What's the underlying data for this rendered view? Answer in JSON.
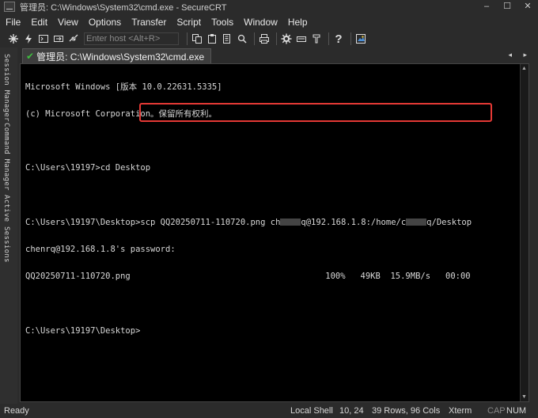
{
  "window": {
    "title": "管理员: C:\\Windows\\System32\\cmd.exe - SecureCRT",
    "controls": [
      "–",
      "☐",
      "✕"
    ]
  },
  "menu": {
    "items": [
      "File",
      "Edit",
      "View",
      "Options",
      "Transfer",
      "Script",
      "Tools",
      "Window",
      "Help"
    ]
  },
  "toolbar": {
    "host_placeholder": "Enter host <Alt+R>"
  },
  "sidebar": {
    "tabs": [
      "Session Manager",
      "Command Manager",
      "Active Sessions"
    ]
  },
  "tab": {
    "label": "管理员: C:\\Windows\\System32\\cmd.exe",
    "nav": "◂ ▸"
  },
  "terminal": {
    "lines": [
      "Microsoft Windows [版本 10.0.22631.5335]",
      "(c) Microsoft Corporation。保留所有权利。",
      "",
      "C:\\Users\\19197>cd Desktop",
      "",
      "C:\\Users\\19197\\Desktop>scp QQ20250711-110720.png ch",
      "chenrq@192.168.1.8's password:",
      "QQ20250711-110720.png                                       100%   49KB  15.9MB/s   00:00",
      "",
      "C:\\Users\\19197\\Desktop>"
    ],
    "scp_line": {
      "prefix": "C:\\Users\\19197\\Desktop>scp QQ20250711-110720.png ch",
      "middle": "q@192.168.1.8:/home/c",
      "suffix": "q/Desktop"
    }
  },
  "status": {
    "ready": "Ready",
    "shell": "Local Shell",
    "cursor": "10,  24",
    "size": "39 Rows, 96 Cols",
    "term": "Xterm",
    "cap": "CAP",
    "num": "NUM"
  },
  "colors": {
    "highlight_box": "#e53935",
    "connected_check": "#3fbf3f"
  }
}
